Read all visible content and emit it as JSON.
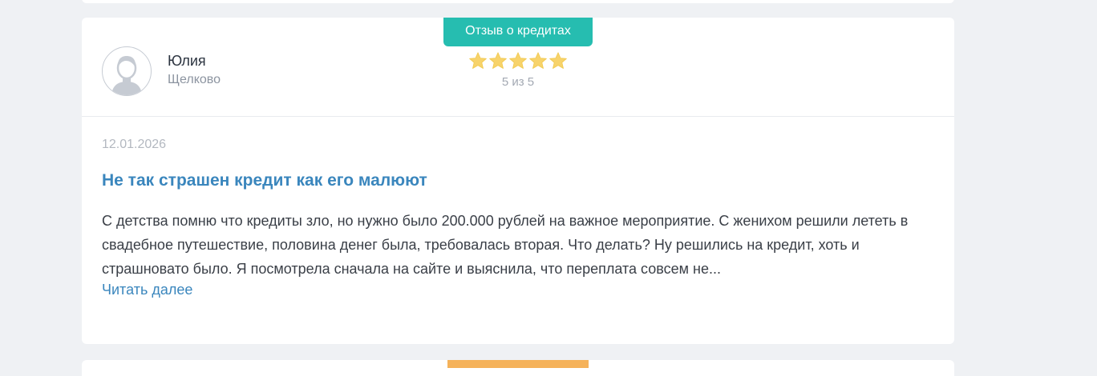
{
  "review": {
    "badge": "Отзыв о кредитах",
    "author": {
      "name": "Юлия",
      "city": "Щелково"
    },
    "rating": {
      "stars": 5,
      "max": 5,
      "text": "5 из 5"
    },
    "date": "12.01.2026",
    "title": "Не так страшен кредит как его малюют",
    "text": "С детства помню что кредиты зло, но нужно было 200.000 рублей на важное мероприятие. С женихом решили лететь в свадебное путешествие, половина денег была, требовалась вторая. Что делать? Ну решились на кредит, хоть и страшновато было. Я посмотрела сначала на сайте и выяснила, что переплата совсем не...",
    "read_more": "Читать далее"
  },
  "icons": {
    "avatar": "user-avatar-icon",
    "star": "star-icon"
  },
  "colors": {
    "accent_teal": "#26bdb0",
    "link_blue": "#3a86bd",
    "star_yellow": "#f7d36b",
    "next_badge_orange": "#f5b25a"
  }
}
